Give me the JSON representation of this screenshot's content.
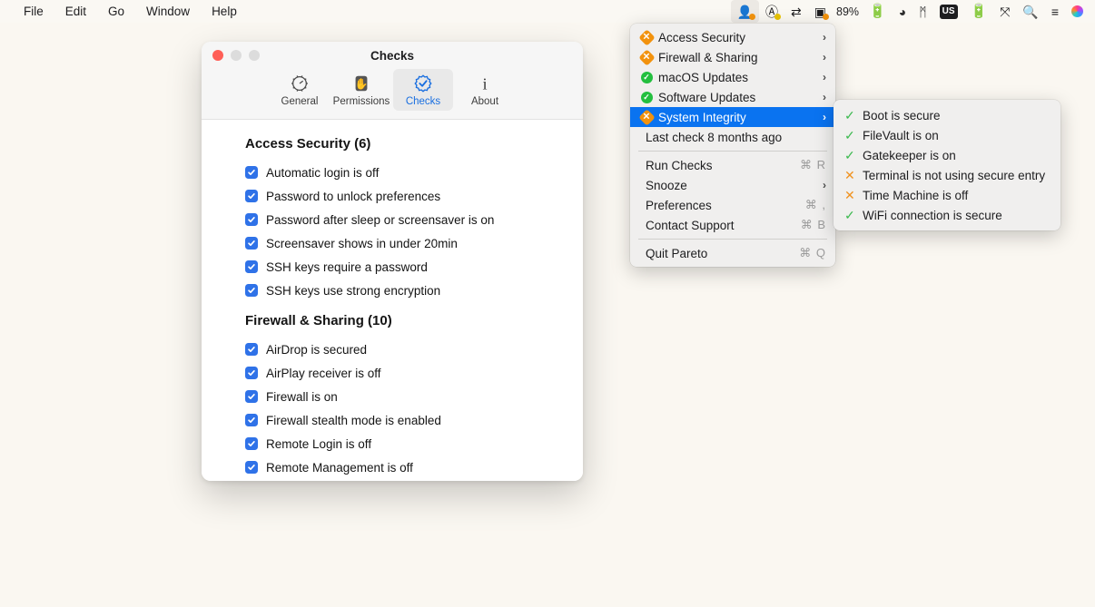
{
  "menubar": {
    "items": [
      {
        "label": "File"
      },
      {
        "label": "Edit"
      },
      {
        "label": "Go"
      },
      {
        "label": "Window"
      },
      {
        "label": "Help"
      }
    ],
    "status": {
      "battery_percent": "89%",
      "icons": [
        {
          "name": "pareto-menubar-icon",
          "glyph": "👤",
          "badge": "#f2920d",
          "active": true
        },
        {
          "name": "app-badge-icon",
          "glyph": "Ⓐ",
          "badge": "#e8c300",
          "active": false
        },
        {
          "name": "transfer-arrows-icon",
          "glyph": "⇄",
          "badge": "",
          "active": false
        },
        {
          "name": "display-icon",
          "glyph": "▣",
          "badge": "#f2920d",
          "active": false
        },
        {
          "name": "battery-icon",
          "glyph": "🔋",
          "badge": "",
          "active": false
        },
        {
          "name": "droplet-icon",
          "glyph": "●",
          "badge": "",
          "active": false
        },
        {
          "name": "bluetooth-icon",
          "glyph": "ᛗ",
          "badge": "",
          "active": false
        },
        {
          "name": "input-source-us-icon",
          "glyph": "US",
          "badge": "",
          "active": false
        },
        {
          "name": "battery-widget-icon",
          "glyph": "🔌",
          "badge": "",
          "active": false
        },
        {
          "name": "link-icon",
          "glyph": "⤧",
          "badge": "",
          "active": false
        },
        {
          "name": "search-icon",
          "glyph": "🔍",
          "badge": "",
          "active": false
        },
        {
          "name": "control-center-icon",
          "glyph": "≡",
          "badge": "",
          "active": false
        },
        {
          "name": "siri-icon",
          "glyph": "●",
          "badge": "",
          "active": false
        }
      ]
    }
  },
  "pareto_menu": {
    "categories": [
      {
        "label": "Access Security",
        "status": "warn",
        "chevron": "›"
      },
      {
        "label": "Firewall & Sharing",
        "status": "warn",
        "chevron": "›"
      },
      {
        "label": "macOS Updates",
        "status": "ok",
        "chevron": "›"
      },
      {
        "label": "Software Updates",
        "status": "ok",
        "chevron": "›"
      },
      {
        "label": "System Integrity",
        "status": "warn",
        "chevron": "›",
        "selected": true
      }
    ],
    "last_check": "Last check 8 months ago",
    "actions": [
      {
        "label": "Run Checks",
        "shortcut": "⌘ R",
        "chevron": ""
      },
      {
        "label": "Snooze",
        "shortcut": "",
        "chevron": "›"
      },
      {
        "label": "Preferences",
        "shortcut": "⌘ ,",
        "chevron": ""
      },
      {
        "label": "Contact Support",
        "shortcut": "⌘ B",
        "chevron": ""
      }
    ],
    "quit": {
      "label": "Quit Pareto",
      "shortcut": "⌘ Q"
    }
  },
  "system_integrity_submenu": {
    "items": [
      {
        "label": "Boot is secure",
        "status": "ok"
      },
      {
        "label": "FileVault is on",
        "status": "ok"
      },
      {
        "label": "Gatekeeper is on",
        "status": "ok"
      },
      {
        "label": "Terminal is not using secure entry",
        "status": "bad"
      },
      {
        "label": "Time Machine is off",
        "status": "bad"
      },
      {
        "label": "WiFi connection is secure",
        "status": "ok"
      }
    ],
    "mark_ok": "✓",
    "mark_bad": "✕"
  },
  "checks_window": {
    "title": "Checks",
    "tabs": [
      {
        "label": "General",
        "icon": "gear-icon",
        "selected": false
      },
      {
        "label": "Permissions",
        "icon": "hand-icon",
        "selected": false
      },
      {
        "label": "Checks",
        "icon": "check-seal-icon",
        "selected": true
      },
      {
        "label": "About",
        "icon": "info-icon",
        "selected": false
      }
    ],
    "sections": [
      {
        "title": "Access Security (6)",
        "checks": [
          {
            "label": "Automatic login is off",
            "checked": true
          },
          {
            "label": "Password to unlock preferences",
            "checked": true
          },
          {
            "label": "Password after sleep or screensaver is on",
            "checked": true
          },
          {
            "label": "Screensaver shows in under 20min",
            "checked": true
          },
          {
            "label": "SSH keys require a password",
            "checked": true
          },
          {
            "label": "SSH keys use strong encryption",
            "checked": true
          }
        ]
      },
      {
        "title": "Firewall & Sharing (10)",
        "checks": [
          {
            "label": "AirDrop is secured",
            "checked": true
          },
          {
            "label": "AirPlay receiver is off",
            "checked": true
          },
          {
            "label": "Firewall is on",
            "checked": true
          },
          {
            "label": "Firewall stealth mode is enabled",
            "checked": true
          },
          {
            "label": "Remote Login is off",
            "checked": true
          },
          {
            "label": "Remote Management is off",
            "checked": true
          }
        ]
      }
    ]
  },
  "colors": {
    "accent_blue": "#0a73f0",
    "checkbox_blue": "#2f72e8",
    "warn_orange": "#f2920d",
    "ok_green": "#23bf3f",
    "desktop": "#faf7f1"
  }
}
